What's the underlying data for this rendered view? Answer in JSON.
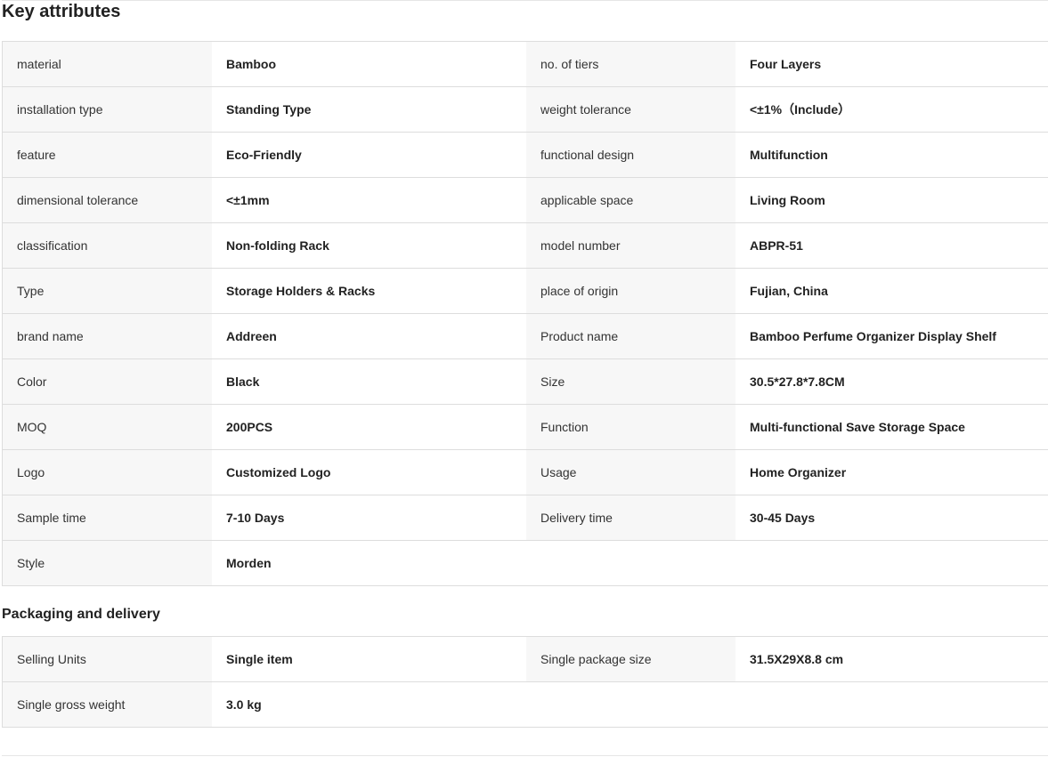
{
  "key_attributes": {
    "title": "Key attributes",
    "rows": [
      {
        "label1": "material",
        "value1": "Bamboo",
        "label2": "no. of tiers",
        "value2": "Four Layers"
      },
      {
        "label1": "installation type",
        "value1": "Standing Type",
        "label2": "weight tolerance",
        "value2": "<±1%（Include）"
      },
      {
        "label1": "feature",
        "value1": "Eco-Friendly",
        "label2": "functional design",
        "value2": "Multifunction"
      },
      {
        "label1": "dimensional tolerance",
        "value1": "<±1mm",
        "label2": "applicable space",
        "value2": "Living Room"
      },
      {
        "label1": "classification",
        "value1": "Non-folding Rack",
        "label2": "model number",
        "value2": "ABPR-51"
      },
      {
        "label1": "Type",
        "value1": "Storage Holders & Racks",
        "label2": "place of origin",
        "value2": "Fujian, China"
      },
      {
        "label1": "brand name",
        "value1": "Addreen",
        "label2": "Product name",
        "value2": "Bamboo Perfume Organizer Display Shelf"
      },
      {
        "label1": "Color",
        "value1": "Black",
        "label2": "Size",
        "value2": "30.5*27.8*7.8CM"
      },
      {
        "label1": "MOQ",
        "value1": "200PCS",
        "label2": "Function",
        "value2": "Multi-functional Save Storage Space"
      },
      {
        "label1": "Logo",
        "value1": "Customized Logo",
        "label2": "Usage",
        "value2": "Home Organizer"
      },
      {
        "label1": "Sample time",
        "value1": "7-10 Days",
        "label2": "Delivery time",
        "value2": "30-45 Days"
      },
      {
        "label1": "Style",
        "value1": "Morden",
        "label2": "",
        "value2": ""
      }
    ]
  },
  "packaging": {
    "title": "Packaging and delivery",
    "rows": [
      {
        "label1": "Selling Units",
        "value1": "Single item",
        "label2": "Single package size",
        "value2": "31.5X29X8.8 cm"
      },
      {
        "label1": "Single gross weight",
        "value1": "3.0 kg",
        "label2": "",
        "value2": ""
      }
    ]
  }
}
